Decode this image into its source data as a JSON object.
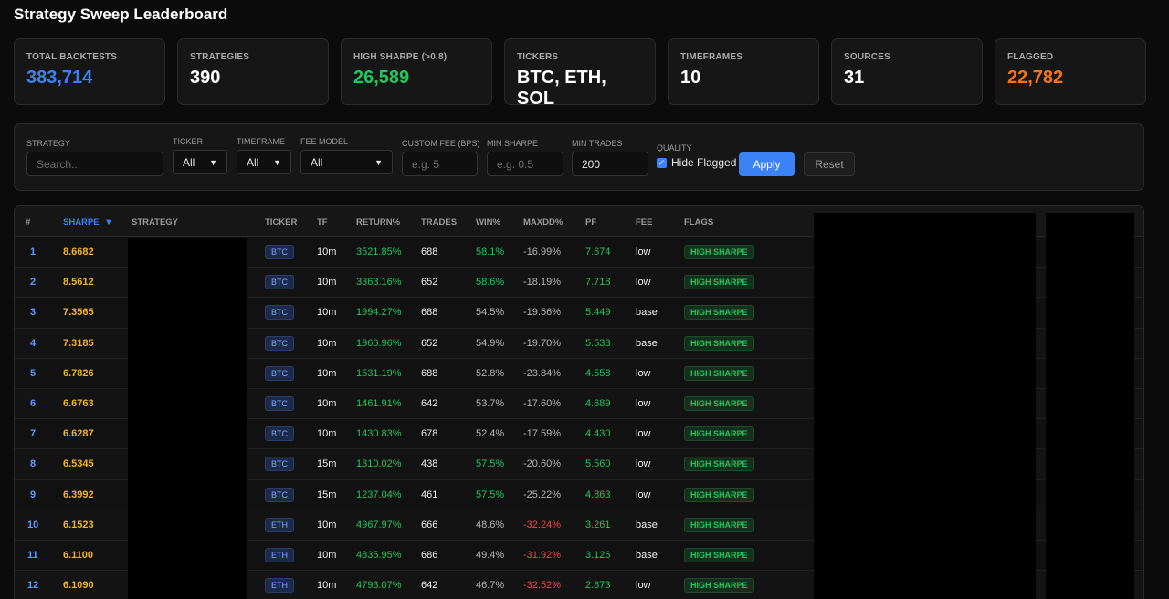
{
  "page": {
    "title": "Strategy Sweep Leaderboard"
  },
  "stats": [
    {
      "label": "Total Backtests",
      "value": "383,714",
      "color": "#3b82f6"
    },
    {
      "label": "Strategies",
      "value": "390",
      "color": "#ffffff"
    },
    {
      "label": "High Sharpe (>0.8)",
      "value": "26,589",
      "color": "#22c55e"
    },
    {
      "label": "Tickers",
      "value": "BTC, ETH, SOL",
      "color": "#ffffff"
    },
    {
      "label": "Timeframes",
      "value": "10",
      "color": "#ffffff"
    },
    {
      "label": "Sources",
      "value": "31",
      "color": "#ffffff"
    },
    {
      "label": "Flagged",
      "value": "22,782",
      "color": "#f97316"
    }
  ],
  "filters": {
    "strategy": {
      "label": "Strategy",
      "placeholder": "Search..."
    },
    "ticker": {
      "label": "Ticker",
      "value": "All"
    },
    "timeframe": {
      "label": "Timeframe",
      "value": "All"
    },
    "fee_model": {
      "label": "Fee Model",
      "value": "All"
    },
    "custom_fee": {
      "label": "Custom Fee (BPS)",
      "placeholder": "e.g. 5"
    },
    "min_sharpe": {
      "label": "Min Sharpe",
      "placeholder": "e.g. 0.5"
    },
    "min_trades": {
      "label": "Min Trades",
      "value": "200"
    },
    "quality": {
      "label": "Quality",
      "checkbox_label": "Hide Flagged",
      "checked": true
    },
    "apply_label": "Apply",
    "reset_label": "Reset"
  },
  "table": {
    "columns": {
      "rank": "#",
      "sharpe": "Sharpe",
      "sort_indicator": "▼",
      "strategy": "Strategy",
      "ticker": "Ticker",
      "tf": "TF",
      "return": "Return%",
      "trades": "Trades",
      "win": "Win%",
      "maxdd": "MaxDD%",
      "pf": "PF",
      "fee": "Fee",
      "flags": "Flags"
    },
    "rows": [
      {
        "rank": "1",
        "sharpe": "8.6682",
        "ticker": "BTC",
        "tf": "10m",
        "ret": "3521.85%",
        "trades": "688",
        "win": "58.1%",
        "win_good": true,
        "maxdd": "-16.99%",
        "dd_bad": false,
        "pf": "7.674",
        "fee": "low",
        "flag": "HIGH SHARPE"
      },
      {
        "rank": "2",
        "sharpe": "8.5612",
        "ticker": "BTC",
        "tf": "10m",
        "ret": "3363.16%",
        "trades": "652",
        "win": "58.6%",
        "win_good": true,
        "maxdd": "-18.19%",
        "dd_bad": false,
        "pf": "7.718",
        "fee": "low",
        "flag": "HIGH SHARPE"
      },
      {
        "rank": "3",
        "sharpe": "7.3565",
        "ticker": "BTC",
        "tf": "10m",
        "ret": "1994.27%",
        "trades": "688",
        "win": "54.5%",
        "win_good": false,
        "maxdd": "-19.56%",
        "dd_bad": false,
        "pf": "5.449",
        "fee": "base",
        "flag": "HIGH SHARPE"
      },
      {
        "rank": "4",
        "sharpe": "7.3185",
        "ticker": "BTC",
        "tf": "10m",
        "ret": "1960.96%",
        "trades": "652",
        "win": "54.9%",
        "win_good": false,
        "maxdd": "-19.70%",
        "dd_bad": false,
        "pf": "5.533",
        "fee": "base",
        "flag": "HIGH SHARPE"
      },
      {
        "rank": "5",
        "sharpe": "6.7826",
        "ticker": "BTC",
        "tf": "10m",
        "ret": "1531.19%",
        "trades": "688",
        "win": "52.8%",
        "win_good": false,
        "maxdd": "-23.84%",
        "dd_bad": false,
        "pf": "4.558",
        "fee": "low",
        "flag": "HIGH SHARPE"
      },
      {
        "rank": "6",
        "sharpe": "6.6763",
        "ticker": "BTC",
        "tf": "10m",
        "ret": "1461.91%",
        "trades": "642",
        "win": "53.7%",
        "win_good": false,
        "maxdd": "-17.60%",
        "dd_bad": false,
        "pf": "4.689",
        "fee": "low",
        "flag": "HIGH SHARPE"
      },
      {
        "rank": "7",
        "sharpe": "6.6287",
        "ticker": "BTC",
        "tf": "10m",
        "ret": "1430.83%",
        "trades": "678",
        "win": "52.4%",
        "win_good": false,
        "maxdd": "-17.59%",
        "dd_bad": false,
        "pf": "4.430",
        "fee": "low",
        "flag": "HIGH SHARPE"
      },
      {
        "rank": "8",
        "sharpe": "6.5345",
        "ticker": "BTC",
        "tf": "15m",
        "ret": "1310.02%",
        "trades": "438",
        "win": "57.5%",
        "win_good": true,
        "maxdd": "-20.60%",
        "dd_bad": false,
        "pf": "5.560",
        "fee": "low",
        "flag": "HIGH SHARPE"
      },
      {
        "rank": "9",
        "sharpe": "6.3992",
        "ticker": "BTC",
        "tf": "15m",
        "ret": "1237.04%",
        "trades": "461",
        "win": "57.5%",
        "win_good": true,
        "maxdd": "-25.22%",
        "dd_bad": false,
        "pf": "4.863",
        "fee": "low",
        "flag": "HIGH SHARPE"
      },
      {
        "rank": "10",
        "sharpe": "6.1523",
        "ticker": "ETH",
        "tf": "10m",
        "ret": "4967.97%",
        "trades": "666",
        "win": "48.6%",
        "win_good": false,
        "maxdd": "-32.24%",
        "dd_bad": true,
        "pf": "3.261",
        "fee": "base",
        "flag": "HIGH SHARPE"
      },
      {
        "rank": "11",
        "sharpe": "6.1100",
        "ticker": "ETH",
        "tf": "10m",
        "ret": "4835.95%",
        "trades": "686",
        "win": "49.4%",
        "win_good": false,
        "maxdd": "-31.92%",
        "dd_bad": true,
        "pf": "3.126",
        "fee": "base",
        "flag": "HIGH SHARPE"
      },
      {
        "rank": "12",
        "sharpe": "6.1090",
        "ticker": "ETH",
        "tf": "10m",
        "ret": "4793.07%",
        "trades": "642",
        "win": "46.7%",
        "win_good": false,
        "maxdd": "-32.52%",
        "dd_bad": true,
        "pf": "2.873",
        "fee": "low",
        "flag": "HIGH SHARPE"
      }
    ]
  }
}
